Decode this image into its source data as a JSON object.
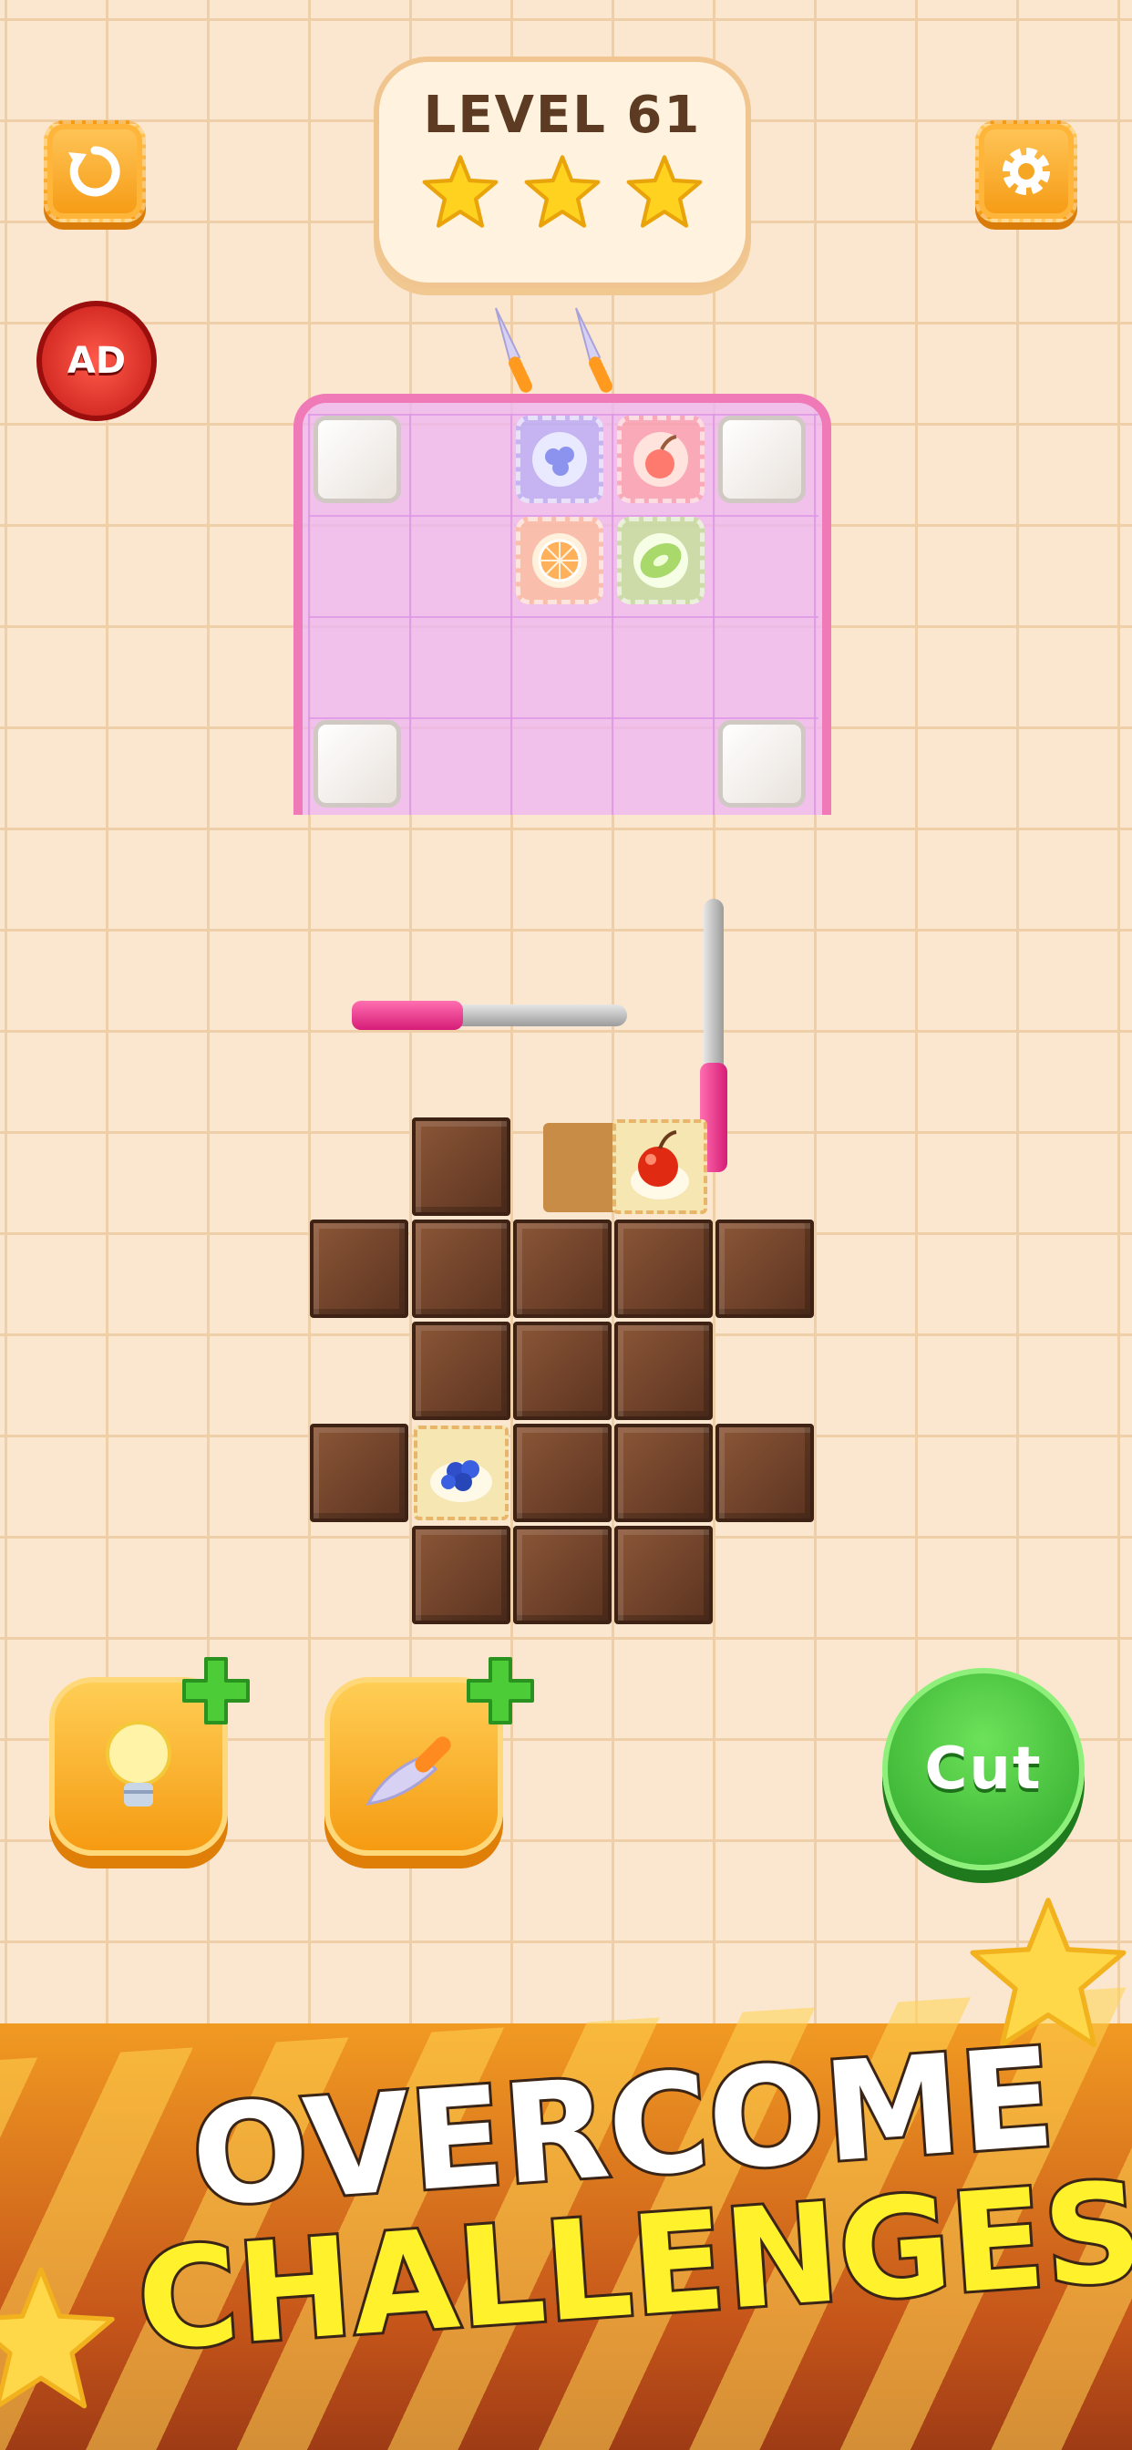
{
  "header": {
    "level_label": "LEVEL 61",
    "stars_earned": 3,
    "stars_total": 3
  },
  "buttons": {
    "ad_label": "AD",
    "cut_label": "Cut"
  },
  "colors": {
    "background": "#fbe7cf",
    "board_pink": "#f07ab7",
    "chocolate": "#6e3f27",
    "orange_button": "#f59b12",
    "green_button": "#3fbf35",
    "star": "#ffd21f"
  },
  "icons": {
    "restart": "refresh-icon",
    "settings": "gear-icon",
    "hint": "lightbulb-icon",
    "knife": "knife-icon",
    "add": "plus-icon"
  },
  "knives_remaining": 2,
  "banner": {
    "line1": "OVERCOME",
    "line2": "CHALLENGES!"
  }
}
